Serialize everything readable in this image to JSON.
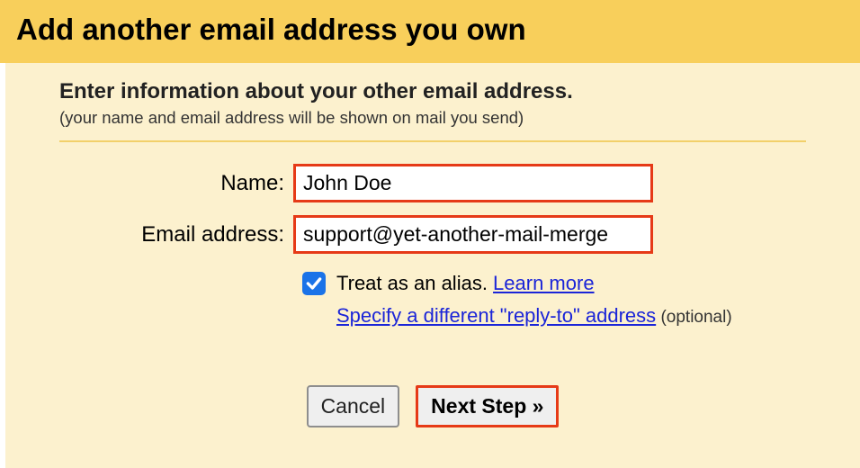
{
  "header": {
    "title": "Add another email address you own"
  },
  "intro": {
    "heading": "Enter information about your other email address.",
    "note": "(your name and email address will be shown on mail you send)"
  },
  "form": {
    "name_label": "Name:",
    "name_value": "John Doe",
    "email_label": "Email address:",
    "email_value": "support@yet-another-mail-merge",
    "alias_text": "Treat as an alias. ",
    "learn_more": "Learn more",
    "reply_to_link": "Specify a different \"reply-to\" address",
    "optional_text": " (optional)"
  },
  "buttons": {
    "cancel": "Cancel",
    "next": "Next Step »"
  }
}
